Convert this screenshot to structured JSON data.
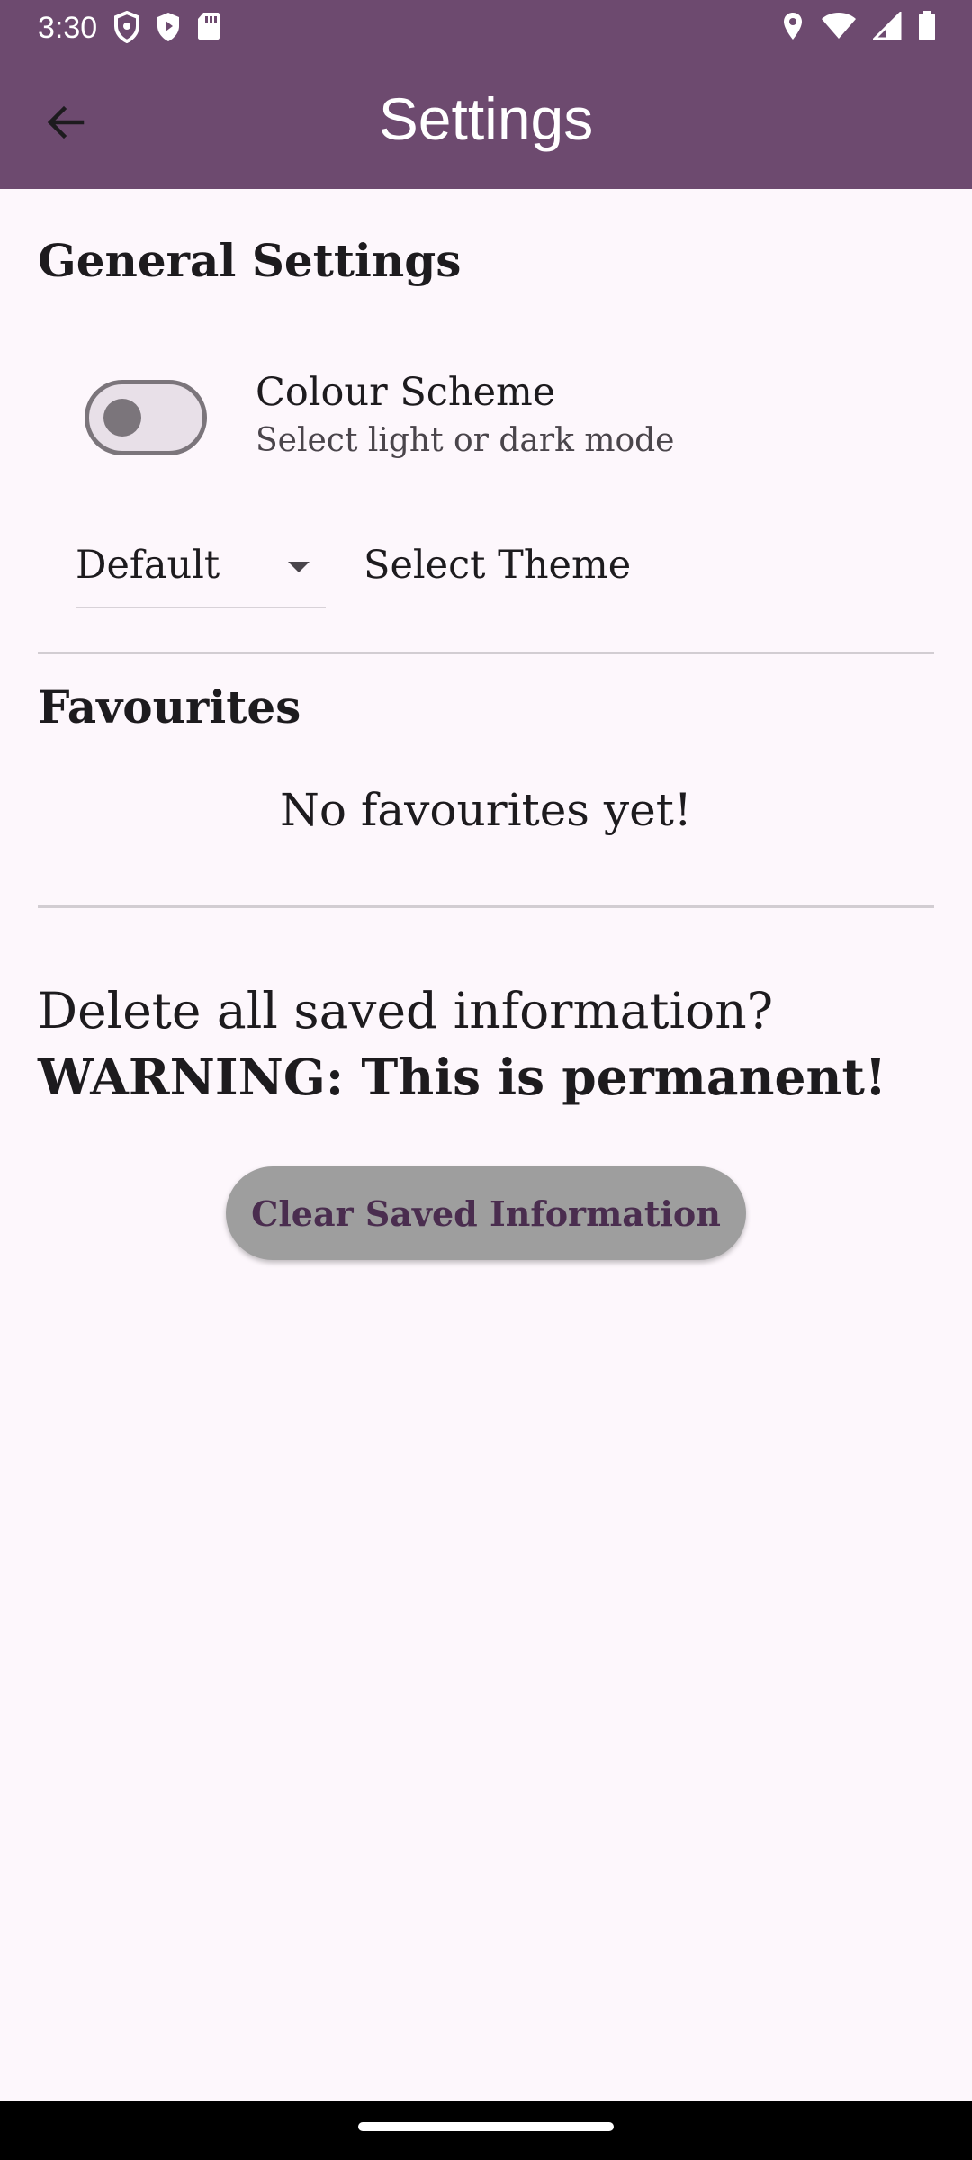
{
  "status_bar": {
    "time": "3:30",
    "left_icons": [
      "shield-outline-icon",
      "shield-play-icon",
      "sd-card-icon"
    ],
    "right_icons": [
      "location-pin-icon",
      "wifi-icon",
      "cellular-signal-icon",
      "battery-icon"
    ]
  },
  "app_bar": {
    "title": "Settings",
    "back_icon": "arrow-back-icon",
    "background_color": "#6d4a6f"
  },
  "general_settings": {
    "heading": "General Settings",
    "colour_scheme": {
      "title": "Colour Scheme",
      "subtitle": "Select light or dark mode",
      "enabled": false
    },
    "theme": {
      "selected": "Default",
      "label": "Select Theme"
    }
  },
  "favourites": {
    "heading": "Favourites",
    "empty_message": "No favourites yet!"
  },
  "danger_zone": {
    "prompt": "Delete all saved information?",
    "warning": "WARNING: This is permanent!",
    "button_label": "Clear Saved Information",
    "button_color": "#9e9e9e",
    "button_text_color": "#4a2d4f"
  },
  "colors": {
    "background": "#fdf7fc",
    "accent": "#6d4a6f"
  }
}
